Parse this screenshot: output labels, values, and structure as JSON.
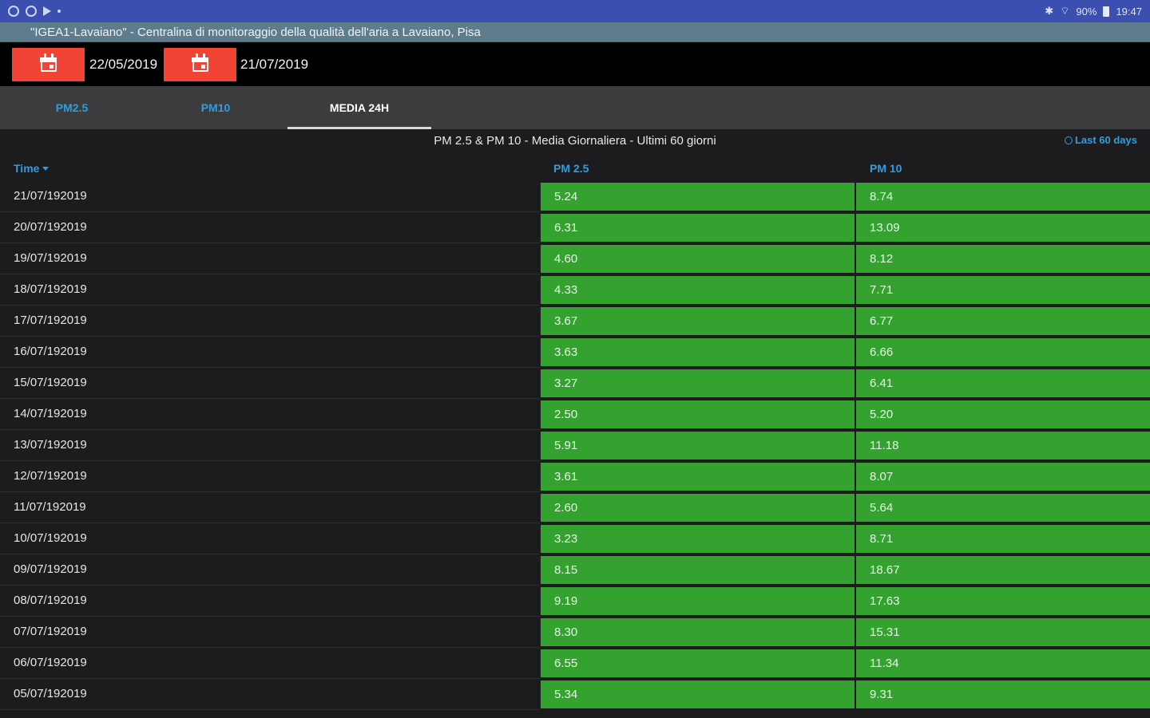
{
  "status_bar": {
    "left_icons": [
      "notification-icon",
      "settings-icon",
      "play-store-icon"
    ],
    "battery": "90%",
    "time": "19:47"
  },
  "title": "\"IGEA1-Lavaiano\" - Centralina di monitoraggio della qualità dell'aria a Lavaiano, Pisa",
  "date_range": {
    "start": "22/05/2019",
    "end": "21/07/2019"
  },
  "tabs": [
    {
      "label": "PM2.5",
      "active": false
    },
    {
      "label": "PM10",
      "active": false
    },
    {
      "label": "MEDIA 24H",
      "active": true
    }
  ],
  "table_title": "PM 2.5 & PM 10 - Media Giornaliera - Ultimi 60 giorni",
  "last_days_label": "Last 60 days",
  "columns": {
    "time": "Time",
    "pm25": "PM 2.5",
    "pm10": "PM 10"
  },
  "colors": {
    "accent_red": "#f24435",
    "tab_blue": "#2f9ee0",
    "good_green": "#33a22f",
    "status_bar": "#3a4fb0",
    "title_bar": "#5f7c8c"
  },
  "rows": [
    {
      "time": "21/07/192019",
      "pm25": "5.24",
      "pm10": "8.74"
    },
    {
      "time": "20/07/192019",
      "pm25": "6.31",
      "pm10": "13.09"
    },
    {
      "time": "19/07/192019",
      "pm25": "4.60",
      "pm10": "8.12"
    },
    {
      "time": "18/07/192019",
      "pm25": "4.33",
      "pm10": "7.71"
    },
    {
      "time": "17/07/192019",
      "pm25": "3.67",
      "pm10": "6.77"
    },
    {
      "time": "16/07/192019",
      "pm25": "3.63",
      "pm10": "6.66"
    },
    {
      "time": "15/07/192019",
      "pm25": "3.27",
      "pm10": "6.41"
    },
    {
      "time": "14/07/192019",
      "pm25": "2.50",
      "pm10": "5.20"
    },
    {
      "time": "13/07/192019",
      "pm25": "5.91",
      "pm10": "11.18"
    },
    {
      "time": "12/07/192019",
      "pm25": "3.61",
      "pm10": "8.07"
    },
    {
      "time": "11/07/192019",
      "pm25": "2.60",
      "pm10": "5.64"
    },
    {
      "time": "10/07/192019",
      "pm25": "3.23",
      "pm10": "8.71"
    },
    {
      "time": "09/07/192019",
      "pm25": "8.15",
      "pm10": "18.67"
    },
    {
      "time": "08/07/192019",
      "pm25": "9.19",
      "pm10": "17.63"
    },
    {
      "time": "07/07/192019",
      "pm25": "8.30",
      "pm10": "15.31"
    },
    {
      "time": "06/07/192019",
      "pm25": "6.55",
      "pm10": "11.34"
    },
    {
      "time": "05/07/192019",
      "pm25": "5.34",
      "pm10": "9.31"
    }
  ]
}
